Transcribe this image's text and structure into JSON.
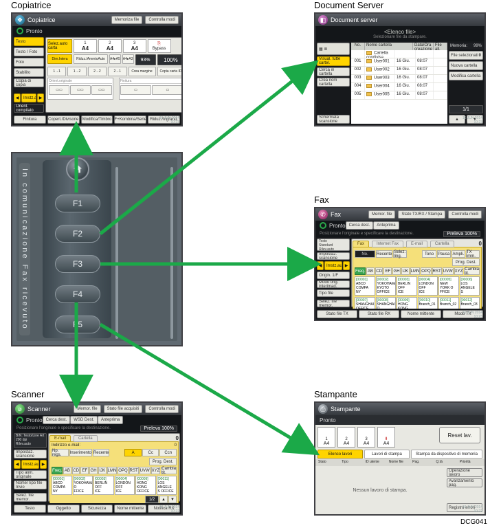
{
  "image_ref": "DCG041",
  "arrow_color": "#1BA948",
  "device": {
    "side_text": "In comunicazione  Fax ricevuto",
    "home_icon": "home-icon",
    "f_keys": [
      "F1",
      "F2",
      "F3",
      "F4",
      "F5"
    ]
  },
  "copier": {
    "caption": "Copiatrice",
    "title": "Copiatrice",
    "status": "Pronto",
    "titlebar_buttons": [
      "Memoriza file",
      "Controlla modi"
    ],
    "side_buttons": [
      {
        "label": "Testo",
        "active": true
      },
      {
        "label": "Testo / Foto"
      },
      {
        "label": "Foto"
      },
      {
        "label": "Stabilito"
      },
      {
        "label": "Copia di copia"
      }
    ],
    "select_paper_label": "Selez.auto carta",
    "paper_trays": [
      {
        "idx": "1",
        "size": "A4"
      },
      {
        "idx": "2",
        "size": "A4"
      },
      {
        "idx": "3",
        "size": "A4"
      }
    ],
    "bypass_label": "Bypass",
    "scale": {
      "full_label": "Dim.Intera",
      "auto_label": "Riduz./AmmtoAuto",
      "ratio_text": "93%",
      "hundred": "100%"
    },
    "extra": {
      "create_margin": "Crea margine",
      "id_card": "Copia carta ID"
    },
    "orient_tab": "Orient.originale",
    "finishing_tab": "Finitura",
    "bottom_left": {
      "prev": "◀",
      "label": "Imstz.auto",
      "next": "▶"
    },
    "full_options": "Orient. compilato",
    "footer": [
      "Finitura",
      "Copert./Divisorie",
      "Modifica/Timbro",
      "F+Kombina/Serie",
      "Riduz./Ingrand."
    ],
    "timestamp": [
      "16 JUN 2014",
      "10:23"
    ]
  },
  "doc_server": {
    "caption": "Document Server",
    "title": "Document server",
    "subtitle": "<Elenco file>",
    "sub_caption": "Selezionare file da stampare.",
    "side_buttons": [
      {
        "label": "Visual. tutte cartel.",
        "active": true
      },
      {
        "label": "Cerca in cartella"
      },
      {
        "label": "Crea nom cartella"
      }
    ],
    "columns": [
      "No.",
      "Nome cartella",
      "Data/Ora creazione",
      "File all."
    ],
    "shared_row": {
      "name": "Cartella condivisa"
    },
    "rows": [
      {
        "no": "001",
        "name": "User001",
        "date": "16 Giu.",
        "time": "08:07"
      },
      {
        "no": "002",
        "name": "User002",
        "date": "16 Giu.",
        "time": "08:07"
      },
      {
        "no": "003",
        "name": "User003",
        "date": "16 Giu.",
        "time": "08:07"
      },
      {
        "no": "004",
        "name": "User004",
        "date": "16 Giu.",
        "time": "08:07"
      },
      {
        "no": "005",
        "name": "User005",
        "date": "16 Giu.",
        "time": "08:07"
      }
    ],
    "right": {
      "memory_label": "Memoria:",
      "memory_value": "99%",
      "selected_files": "File selezionati",
      "selected_count": "0",
      "new_folder": "Nuova cartella",
      "edit_folder": "Modifica cartella",
      "page": "1/1"
    },
    "scan_screen": "Schermata scansione",
    "timestamp": [
      "16 JUN 2014",
      "10:23"
    ]
  },
  "fax": {
    "caption": "Fax",
    "title": "Fax",
    "status": "Pronto",
    "sub_caption": "Posizionare l'originale e specificare la destinazione.",
    "titlebar_buttons": [
      "Memor. file",
      "Stato TX/RX / Stampa",
      "Controlla modi"
    ],
    "right_strip": [
      "Cerca dest.",
      "Anteprima"
    ],
    "zoom": "Preleva 100%",
    "side": {
      "top": [
        "Testo",
        "Standard",
        "Rilev.auto"
      ],
      "settings": "Impostaz. scansione",
      "bottom_nav": {
        "prev": "◀",
        "label": "Imstz.auto",
        "next": "▶"
      },
      "origin": "Origin. 1/F",
      "type": "Modo orig. interimag.",
      "tx_file": "Tipo file"
    },
    "dest_tabs": [
      "Fax",
      "Internet Fax",
      "E-mail",
      "Cartella"
    ],
    "entry_row": {
      "input_placeholder": "No.  ___",
      "buttons": [
        "Recente",
        "Selez. ling."
      ],
      "btnsR": [
        "Tono",
        "Pausa",
        "Ampli.",
        "TX imm."
      ],
      "prog_dest": "Prog. Dest."
    },
    "alpha_row": [
      "Freq.",
      "AB",
      "CD",
      "EF",
      "GH",
      "IJK",
      "LMN",
      "OPQ",
      "RST",
      "UVW",
      "XYZ",
      "Cambia tit."
    ],
    "destinations": [
      {
        "id": "[00001]",
        "name1": "ABCD COMPA",
        "name2": "NY"
      },
      {
        "id": "[00002]",
        "name1": "YOKOHAMA",
        "name2": "KYOTO OFFICE"
      },
      {
        "id": "[00003]",
        "name1": "BERLIN OFF",
        "name2": "ICE"
      },
      {
        "id": "[00004]",
        "name1": "LONDON OFF",
        "name2": "ICE"
      },
      {
        "id": "[00005]",
        "name1": "NEW YORK O",
        "name2": "FFICE"
      },
      {
        "id": "[00006]",
        "name1": "LOS ANGELE",
        "name2": "S"
      }
    ],
    "dest_page": "1/2",
    "sel_file": "Selez. file memor.",
    "footer": [
      "Stato file TX",
      "Stato file RX",
      "Nome mittente",
      "Modo TX"
    ],
    "counter": "0",
    "timestamp": [
      "16 JUN 2014",
      "10:23"
    ]
  },
  "scanner": {
    "caption": "Scanner",
    "title": "Scanner",
    "status": "Pronto",
    "sub_caption": "Posizionare l'originale e specificare la destinazione.",
    "titlebar_buttons": [
      "Memor. file",
      "Stato file acquisiti",
      "Controlla modi"
    ],
    "right_strip": [
      "Cerca dest.",
      "WSD Dest.",
      "Anteprima"
    ],
    "zoom": "Preleva 100%",
    "side": {
      "top": [
        "B/N: Testo/Line Art",
        "200 dpi",
        "Rilev.auto"
      ],
      "settings": "Impostaz. scansione",
      "bottom_nav": {
        "prev": "◀",
        "label": "Imstz.auto",
        "next": "▶"
      },
      "origin": "Tipo alim. originale",
      "file_name": "Nome/Tipo file Invio"
    },
    "dest_tabs": [
      "E-mail",
      "Cartella"
    ],
    "entry_row": {
      "label": "Indirizzo e-mail:",
      "value": "0",
      "buttons": [
        "Np. regs.",
        "Inserimento",
        "Recente"
      ],
      "btnsR": [
        "A",
        "Cc",
        "Ccn"
      ],
      "prog_dest": "Prog. Dest."
    },
    "alpha_row": [
      "Freq.",
      "AB",
      "CD",
      "EF",
      "GH",
      "IJK",
      "LMN",
      "OPQ",
      "RST",
      "UVW",
      "XYZ",
      "Cambia tit."
    ],
    "destinations": [
      {
        "id": "[00001]",
        "name1": "ABCD COMPA",
        "name2": "NY"
      },
      {
        "id": "[00002]",
        "name1": "YOKOHAMA O",
        "name2": "FFICE"
      },
      {
        "id": "[00003]",
        "name1": "BERLIN OFF",
        "name2": "ICE"
      },
      {
        "id": "[00004]",
        "name1": "LONDON OFF",
        "name2": "ICE"
      },
      {
        "id": "[00009]",
        "name1": "HONG KONG",
        "name2": "OFFICE"
      },
      {
        "id": "[00011]",
        "name1": "LOS ANGELE",
        "name2": "S OFFICE"
      }
    ],
    "dest_page": "1/2",
    "sel_file": "Selez. file memor.",
    "footer": [
      "Testo",
      "Oggetto",
      "Sicurezza",
      "Nome mittente",
      "Notifica RX"
    ],
    "counter": "0",
    "timestamp": [
      "16 JUN 2014",
      "10:22"
    ]
  },
  "printer": {
    "caption": "Stampante",
    "title": "Stampante",
    "status": "Pronto",
    "trays": [
      {
        "idx": "1",
        "size": "A4"
      },
      {
        "idx": "2",
        "size": "A4"
      },
      {
        "idx": "3",
        "size": "A4"
      },
      {
        "idx": "4",
        "size": "A4"
      }
    ],
    "reset": "Reset lav.",
    "tabs": [
      "Elenco lavori",
      "Lavori di stampa",
      "Stampa da dispositivo di memoria"
    ],
    "columns": [
      "Stato",
      "Tipo",
      "ID utente",
      "Nome file",
      "Pag.",
      "Q.tà",
      "Priorità"
    ],
    "right_actions": [
      "Operazione lavoro",
      "Avanzamento pag."
    ],
    "empty_msg": "Nessun lavoro di stampa.",
    "error_log": "Registro errori",
    "timestamp": [
      "16 JUN 2014",
      "10:22"
    ]
  }
}
